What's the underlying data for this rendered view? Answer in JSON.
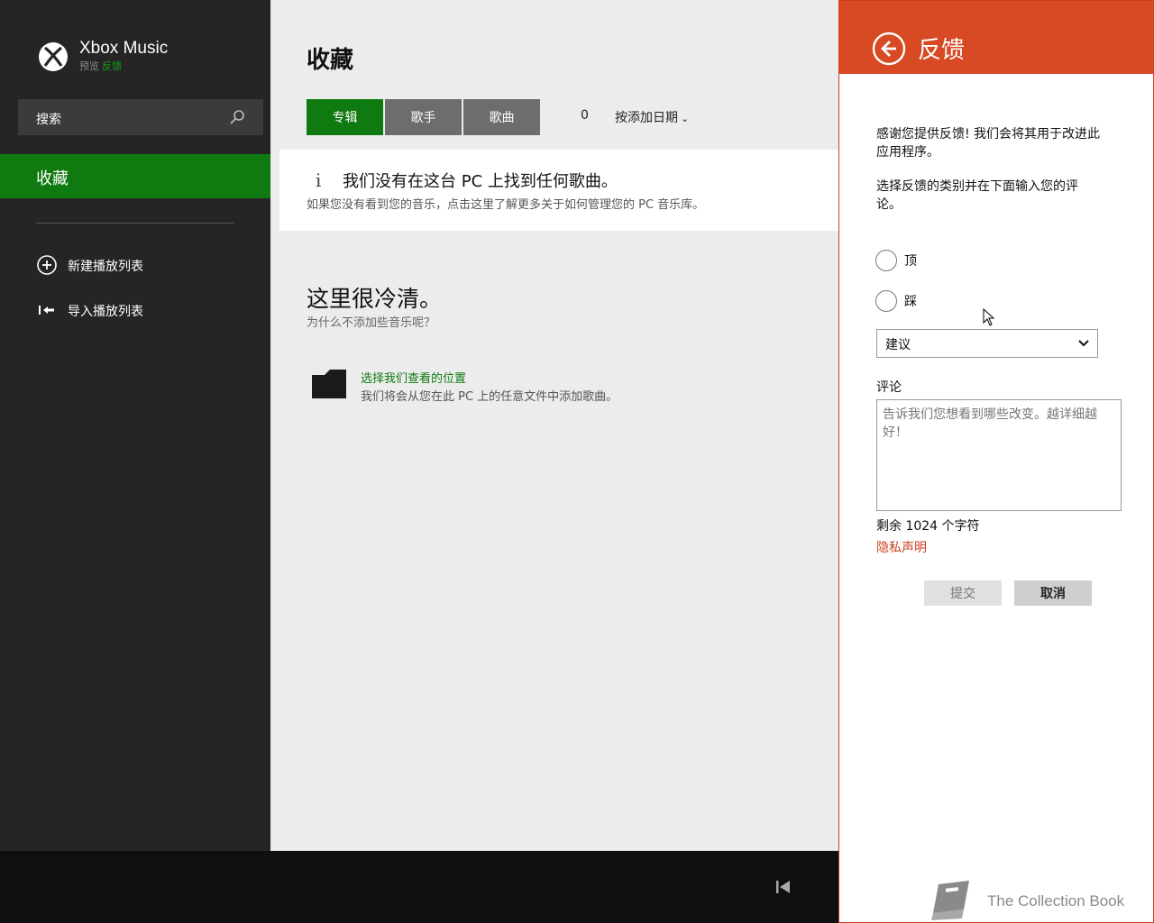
{
  "app": {
    "title": "Xbox Music",
    "subtitle": "预览",
    "feedback_link": "反馈"
  },
  "search": {
    "text": "搜索"
  },
  "sidebar": {
    "active_item": "收藏",
    "items": [
      {
        "label": "新建播放列表",
        "icon": "add-circle-icon"
      },
      {
        "label": "导入播放列表",
        "icon": "import-icon"
      }
    ]
  },
  "main": {
    "title": "收藏",
    "tabs": [
      {
        "label": "专辑",
        "active": true
      },
      {
        "label": "歌手",
        "active": false
      },
      {
        "label": "歌曲",
        "active": false
      }
    ],
    "count": "0",
    "sort": "按添加日期",
    "info": {
      "icon": "i",
      "title": "我们没有在这台 PC 上找到任何歌曲。",
      "desc": "如果您没有看到您的音乐，点击这里了解更多关于如何管理您的 PC 音乐库。"
    },
    "empty": {
      "title": "这里很冷清。",
      "sub": "为什么不添加些音乐呢？",
      "link": "选择我们查看的位置",
      "link_desc": "我们将会从您在此 PC 上的任意文件中添加歌曲。"
    }
  },
  "feedback": {
    "title": "反馈",
    "intro": "感谢您提供反馈! 我们会将其用于改进此应用程序。",
    "instruction": "选择反馈的类别并在下面输入您的评论。",
    "options": [
      "顶",
      "踩"
    ],
    "category": "建议",
    "comment_label": "评论",
    "comment_placeholder": "告诉我们您想看到哪些改变。越详细越好！",
    "remaining": "剩余 1024 个字符",
    "privacy": "隐私声明",
    "submit": "提交",
    "cancel": "取消"
  },
  "watermark": {
    "text": "The Collection Book"
  },
  "colors": {
    "accent_green": "#0f7a0f",
    "panel_orange": "#d84a23",
    "sidebar_bg": "#252525"
  }
}
